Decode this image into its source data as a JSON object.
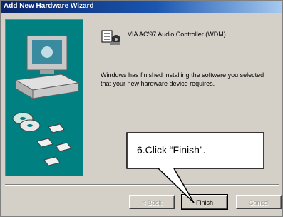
{
  "window": {
    "title": "Add New Hardware Wizard"
  },
  "device": {
    "name": "VIA AC'97 Audio Controller (WDM)",
    "icon": "audio-device-icon"
  },
  "message": "Windows has finished installing the software you selected that your new hardware device requires.",
  "buttons": {
    "back": "< Back",
    "finish": "Finish",
    "cancel": "Cancel"
  },
  "callout": {
    "text": "6.Click “Finish”."
  },
  "colors": {
    "titlebar_start": "#0a2468",
    "titlebar_end": "#a6caf0",
    "illustration_bg": "#008080",
    "dialog_bg": "#d4d0c8"
  }
}
